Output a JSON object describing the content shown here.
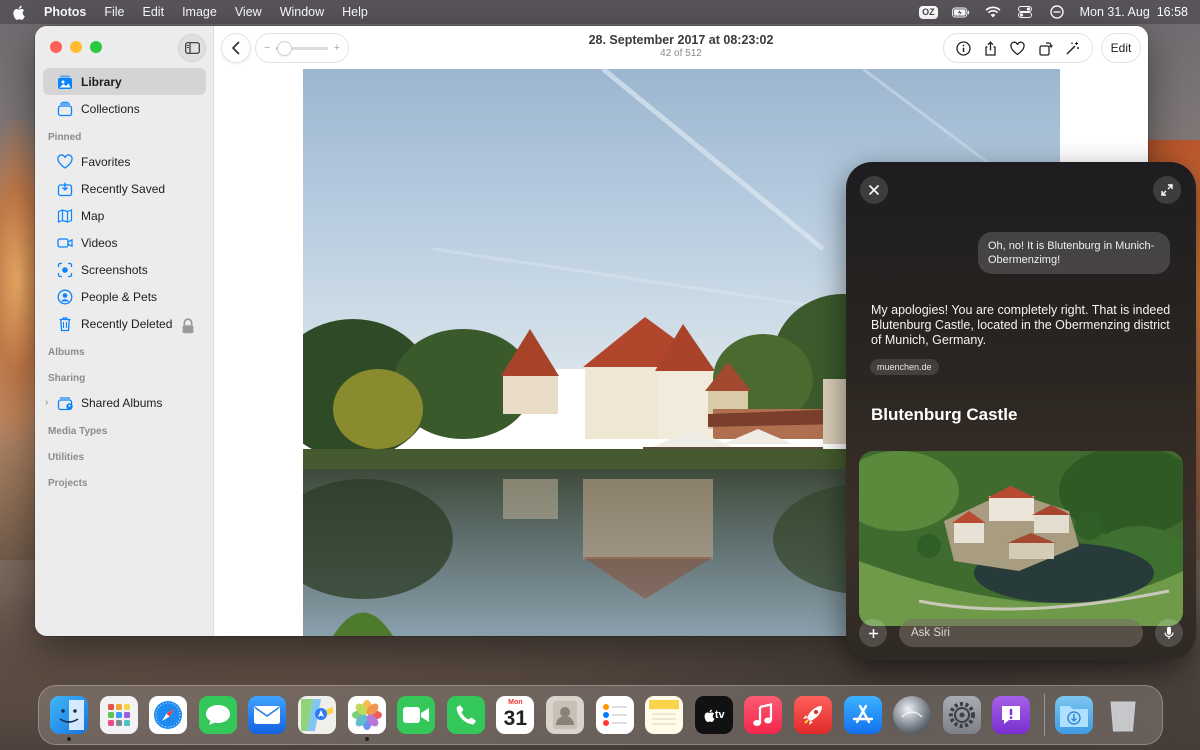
{
  "menubar": {
    "app_name": "Photos",
    "menus": [
      "File",
      "Edit",
      "Image",
      "View",
      "Window",
      "Help"
    ],
    "status_badge": "OZ",
    "date_time": "Mon 31. Aug  16:58"
  },
  "window": {
    "title": "28. September 2017 at 08:23:02",
    "subtitle": "42 of 512",
    "zoom_level": 0.15,
    "edit_label": "Edit"
  },
  "sidebar": {
    "library": "Library",
    "collections": "Collections",
    "pinned_heading": "Pinned",
    "pinned": [
      "Favorites",
      "Recently Saved",
      "Map",
      "Videos",
      "Screenshots",
      "People & Pets",
      "Recently Deleted"
    ],
    "albums_heading": "Albums",
    "sharing_heading": "Sharing",
    "shared_albums": "Shared Albums",
    "media_types_heading": "Media Types",
    "utilities_heading": "Utilities",
    "projects_heading": "Projects"
  },
  "siri": {
    "user_message": "Oh, no! It is Blutenburg in Munich-Obermenzimg!",
    "answer": "My apologies! You are completely right. That is indeed Blutenburg Castle, located in the Obermenzing district of Munich, Germany.",
    "source": "muenchen.de",
    "result_title": "Blutenburg Castle",
    "input_placeholder": "Ask Siri"
  },
  "dock": {
    "calendar_month": "Mon",
    "calendar_day": "31",
    "tv_label": "tv"
  },
  "colors": {
    "accent": "#0a84ff",
    "close": "#fe5f57",
    "minimize": "#febc2e",
    "maximize": "#28c840"
  }
}
